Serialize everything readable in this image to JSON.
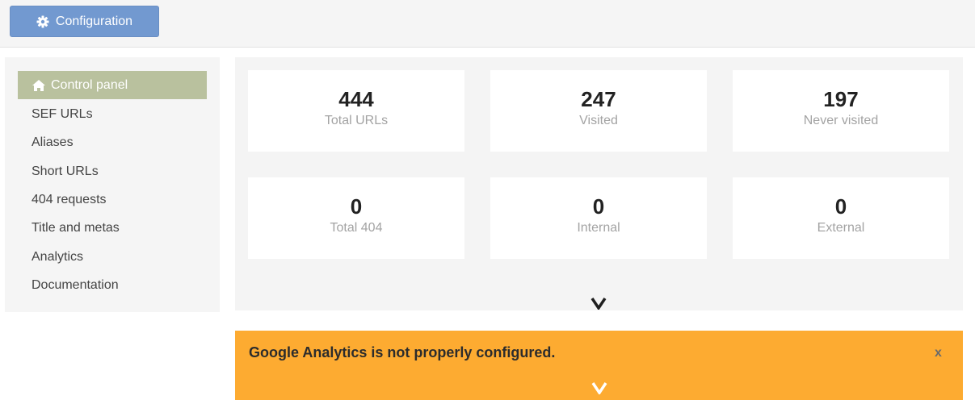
{
  "toolbar": {
    "config_label": "Configuration"
  },
  "sidebar": {
    "items": [
      {
        "label": "Control panel"
      },
      {
        "label": "SEF URLs"
      },
      {
        "label": "Aliases"
      },
      {
        "label": "Short URLs"
      },
      {
        "label": "404 requests"
      },
      {
        "label": "Title and metas"
      },
      {
        "label": "Analytics"
      },
      {
        "label": "Documentation"
      }
    ]
  },
  "stats": [
    {
      "value": "444",
      "label": "Total URLs"
    },
    {
      "value": "247",
      "label": "Visited"
    },
    {
      "value": "197",
      "label": "Never visited"
    },
    {
      "value": "0",
      "label": "Total 404"
    },
    {
      "value": "0",
      "label": "Internal"
    },
    {
      "value": "0",
      "label": "External"
    }
  ],
  "alert": {
    "message": "Google Analytics is not properly configured.",
    "close": "x"
  },
  "colors": {
    "primary": "#7299d0",
    "active_nav": "#b9c19e",
    "warning": "#fdab31"
  }
}
